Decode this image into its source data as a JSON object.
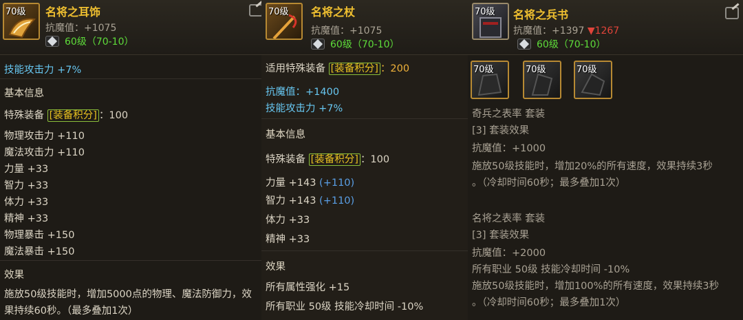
{
  "panel1": {
    "level_badge": "70级",
    "name": "名将之耳饰",
    "stat": "抗魔值：+1075",
    "gem_text": "60级（70-10）",
    "lines": {
      "skill_atk": "技能攻击力 +7%",
      "basic_info": "基本信息",
      "special_pre": "特殊装备 ",
      "special_tag": "[装备积分]",
      "special_post": "：100",
      "phys_atk": "物理攻击力 +110",
      "mag_atk": "魔法攻击力 +110",
      "str": "力量 +33",
      "int": "智力 +33",
      "vit": "体力 +33",
      "spi": "精神 +33",
      "phys_crit": "物理暴击 +150",
      "mag_crit": "魔法暴击 +150",
      "effect_title": "效果",
      "effect_1": "施放50级技能时，增加5000点的物理、魔法防御力，效",
      "effect_2": "果持续60秒。（最多叠加1次）"
    }
  },
  "panel2": {
    "level_badge": "70级",
    "name": "名将之杖",
    "stat": "抗魔值：+1075",
    "gem_text": "60级（70-10）",
    "lines": {
      "applicable_pre": "适用特殊装备 ",
      "applicable_tag": "[装备积分]",
      "applicable_post": "：200",
      "magic_res": "抗魔值：+1400",
      "skill_atk": "技能攻击力 +7%",
      "basic_info": "基本信息",
      "special_pre": "特殊装备 ",
      "special_tag": "[装备积分]",
      "special_post": "：100",
      "str": "力量 +143 ",
      "str_bonus": "(+110)",
      "int": "智力 +143 ",
      "int_bonus": "(+110)",
      "vit": "体力 +33",
      "spi": "精神 +33",
      "effect_title": "效果",
      "effect_1": "所有属性强化 +15",
      "effect_2": "所有职业 50级 技能冷却时间 -10%"
    }
  },
  "panel3": {
    "level_badge": "70级",
    "name": "名将之兵书",
    "stat": "抗魔值：+1397 ",
    "stat_down": "▼1267",
    "gem_text": "60级（70-10）",
    "mini_items": [
      "70级",
      "70级",
      "70级"
    ],
    "lines": {
      "set1_name": "奇兵之表率  套装",
      "set1_effect": "[3] 套装效果",
      "set1_res": "抗魔值：+1000",
      "set1_desc_1": "施放50级技能时，增加20%的所有速度，效果持续3秒",
      "set1_desc_2": "。（冷却时间60秒；最多叠加1次）",
      "set2_name": "名将之表率  套装",
      "set2_effect": "[3] 套装效果",
      "set2_res": "抗魔值：+2000",
      "set2_cd": "所有职业 50级 技能冷却时间 -10%",
      "set2_desc_1": "施放50级技能时，增加100%的所有速度，效果持续3秒",
      "set2_desc_2": "。（冷却时间60秒；最多叠加1次）"
    }
  },
  "colors": {
    "name_gold": "#f0c030",
    "gem_green": "#5edc3a",
    "skill_cyan": "#67c6f0",
    "bonus_blue": "#5a9fe6",
    "tag_yellow": "#e8c020",
    "down_red": "#e0443a"
  },
  "icons": {
    "earring": "earring-icon",
    "staff": "staff-icon",
    "book": "book-icon",
    "gem": "diamond-gem-icon",
    "edit": "edit-icon"
  }
}
